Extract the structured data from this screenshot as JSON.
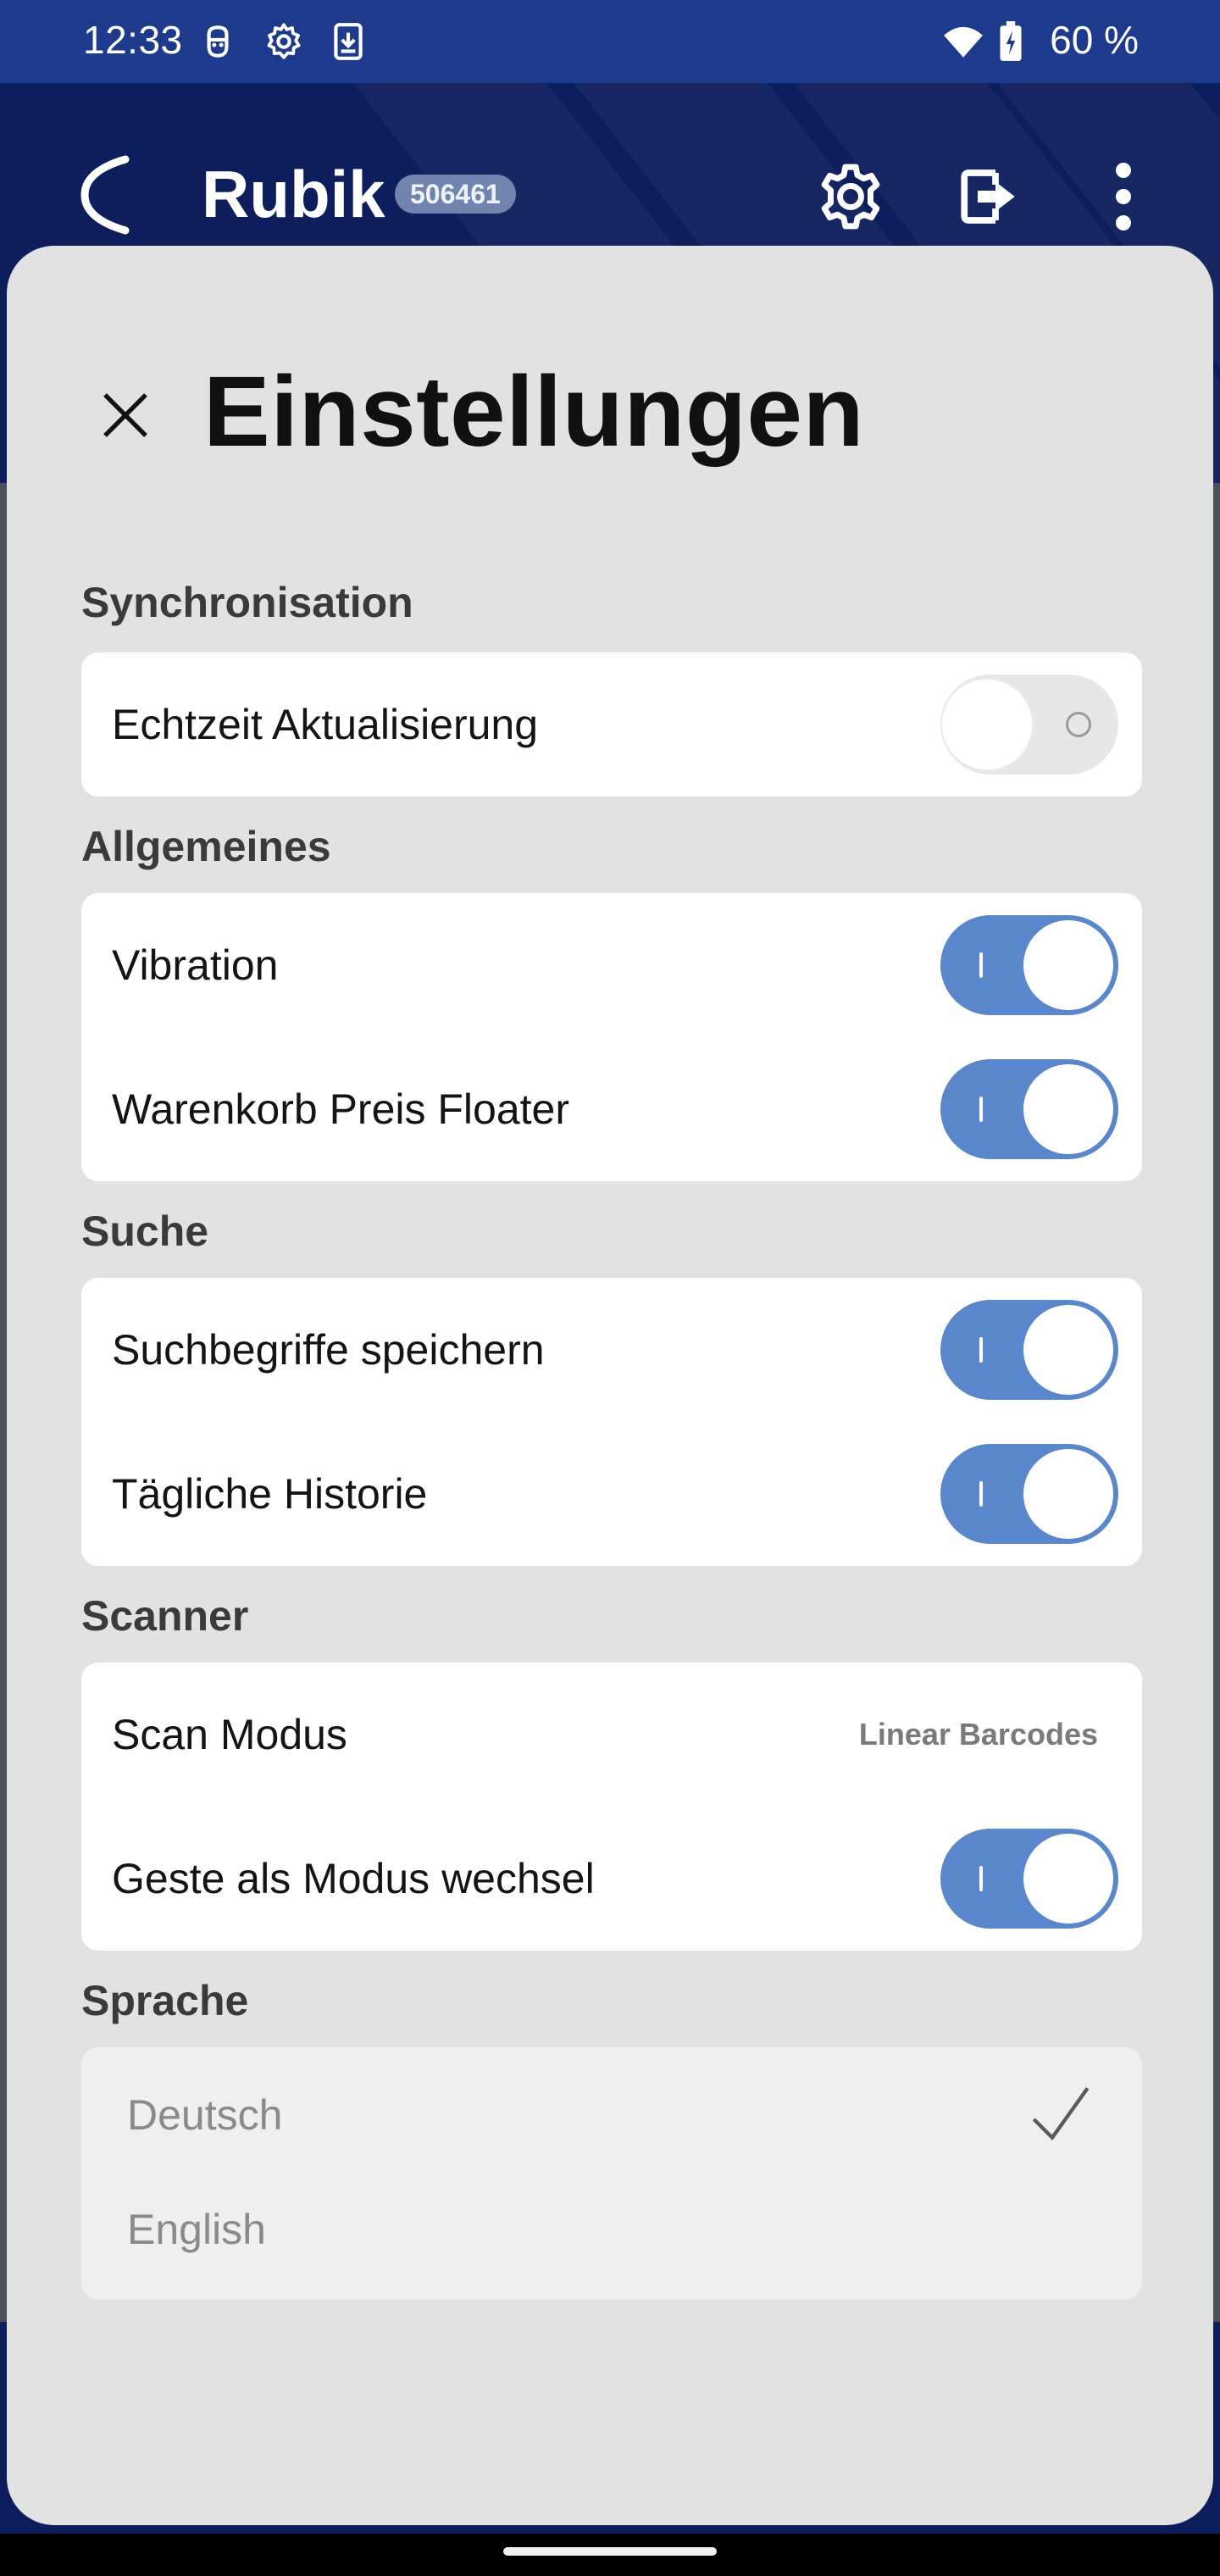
{
  "status_bar": {
    "time": "12:33",
    "battery": "60 %",
    "icons": [
      "face-icon",
      "gear-icon",
      "download-icon",
      "wifi-icon",
      "battery-icon"
    ]
  },
  "toolbar": {
    "title": "Rubik",
    "badge": "506461",
    "icons": [
      "logo-icon",
      "settings-icon",
      "logout-icon",
      "more-vert-icon"
    ]
  },
  "sheet": {
    "title": "Einstellungen",
    "close_icon": "close-icon",
    "sections": {
      "sync": {
        "label": "Synchronisation",
        "realtime": {
          "label": "Echtzeit Aktualisierung",
          "enabled": false
        }
      },
      "general": {
        "label": "Allgemeines",
        "vibration": {
          "label": "Vibration",
          "enabled": true
        },
        "cart_floater": {
          "label": "Warenkorb Preis Floater",
          "enabled": true
        }
      },
      "search": {
        "label": "Suche",
        "save_terms": {
          "label": "Suchbegriffe speichern",
          "enabled": true
        },
        "daily_history": {
          "label": "Tägliche Historie",
          "enabled": true
        }
      },
      "scanner": {
        "label": "Scanner",
        "scan_mode": {
          "label": "Scan Modus",
          "value": "Linear Barcodes"
        },
        "gesture": {
          "label": "Geste als Modus wechsel",
          "enabled": true
        }
      },
      "language": {
        "label": "Sprache",
        "options": [
          {
            "label": "Deutsch",
            "selected": true
          },
          {
            "label": "English",
            "selected": false
          }
        ]
      }
    }
  },
  "colors": {
    "status_bar": "#1d3a8c",
    "app_bg": "#0d1e5c",
    "sheet_bg": "#e2e2e2",
    "toggle_on": "#5a87cc",
    "toggle_off": "#e7e7e7"
  }
}
